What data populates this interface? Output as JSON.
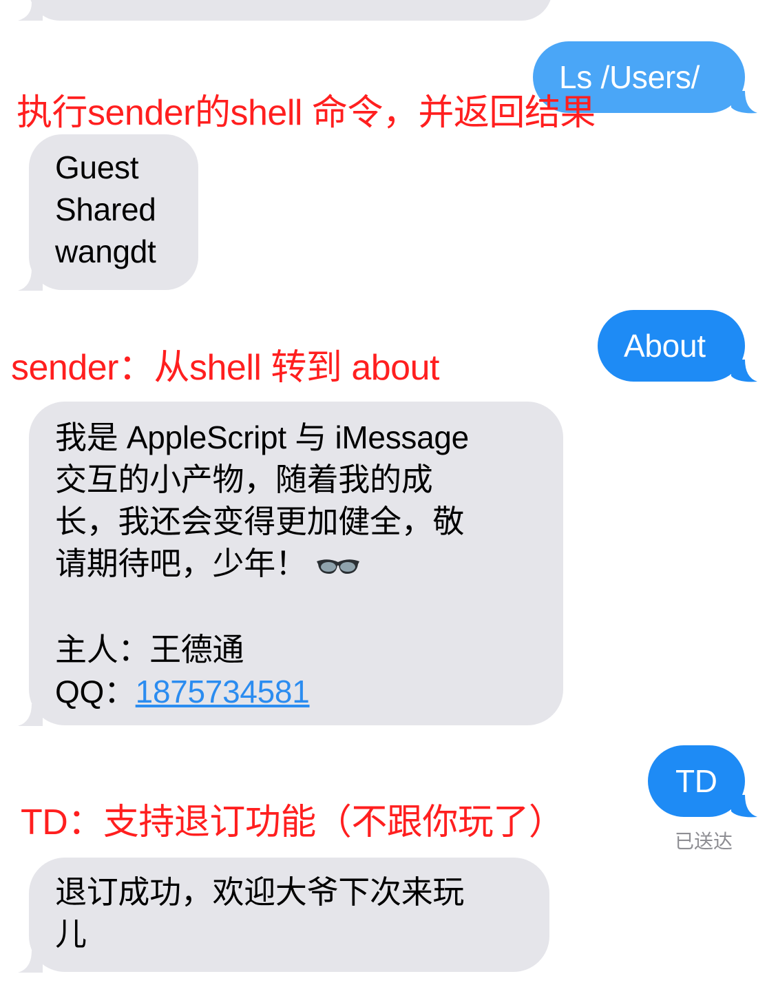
{
  "thread": {
    "messages": [
      {
        "from": "me",
        "text": "Ls /Users/"
      },
      {
        "from": "them",
        "lines": [
          "Guest",
          "Shared",
          "wangdt"
        ]
      },
      {
        "from": "me",
        "text": "About"
      },
      {
        "from": "them",
        "lines": [
          "我是 AppleScript 与 iMessage",
          "交互的小产物，随着我的成",
          "长，我还会变得更加健全，敬",
          "请期待吧，少年！"
        ],
        "emoji": "dark-sunglasses-emoji",
        "owner_label": "主人：王德通",
        "qq_label": "QQ：",
        "qq_number": "1875734581"
      },
      {
        "from": "me",
        "text": "TD",
        "status": "已送达"
      },
      {
        "from": "them",
        "lines": [
          "退订成功，欢迎大爷下次来玩",
          "儿"
        ]
      }
    ]
  },
  "annotations": {
    "shell": "执行sender的shell 命令，并返回结果",
    "about": "sender：从shell 转到 about",
    "td": "TD：支持退订功能（不跟你玩了）"
  },
  "colors": {
    "sent_bubble": "#1e8bf5",
    "received_bubble": "#e5e5ea",
    "annotation": "#ff1f1f",
    "link": "#2b8cf0",
    "status_text": "#8e8e93"
  }
}
